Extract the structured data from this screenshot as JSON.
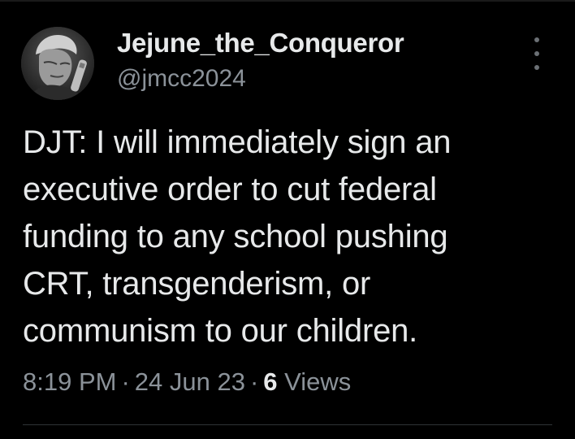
{
  "author": {
    "display_name": "Jejune_the_Conqueror",
    "handle": "@jmcc2024",
    "avatar_icon": "profile-avatar"
  },
  "more_icon": "more-vertical-icon",
  "tweet": {
    "lines": [
      "DJT: I will immediately sign an",
      "executive order to cut federal",
      "funding to any school pushing",
      "CRT, transgenderism, or",
      "communism to our children."
    ]
  },
  "meta": {
    "time": "8:19 PM",
    "separator": "·",
    "date": "24 Jun 23",
    "views_count": "6",
    "views_label": "Views"
  },
  "colors": {
    "background": "#000000",
    "text": "#e7e9ea",
    "secondary": "#8b9299"
  }
}
